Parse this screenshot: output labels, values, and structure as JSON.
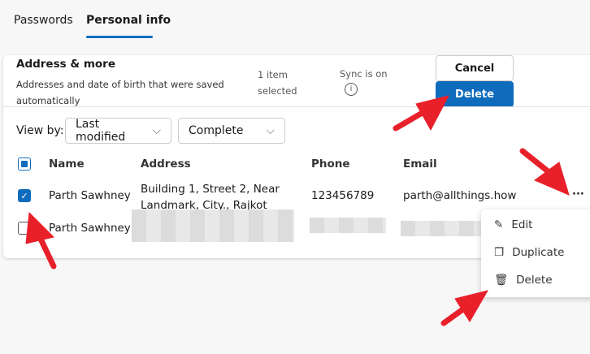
{
  "tabs": [
    "Passwords",
    "Personal info"
  ],
  "section": {
    "title": "Address & more",
    "description": "Addresses and date of birth that were saved automatically",
    "selection": [
      "1 item",
      "selected"
    ],
    "sync": "Sync is on"
  },
  "actions": {
    "cancel": "Cancel",
    "delete": "Delete"
  },
  "view_by": {
    "label": "View by:",
    "sort": "Last modified",
    "filter": "Complete"
  },
  "table": {
    "headers": [
      "Name",
      "Address",
      "Phone",
      "Email"
    ],
    "rows": [
      {
        "name": "Parth Sawhney",
        "address": [
          "Building 1, Street 2, Near",
          "Landmark, City., Rajkot"
        ],
        "phone": "123456789",
        "email": "parth@allthings.how",
        "checked": true
      },
      {
        "name": "Parth Sawhney",
        "checked": false
      }
    ]
  },
  "context_menu": [
    "Edit",
    "Duplicate",
    "Delete"
  ],
  "colors": {
    "accent": "#0f6cbd",
    "annotation": "#e8202a"
  }
}
